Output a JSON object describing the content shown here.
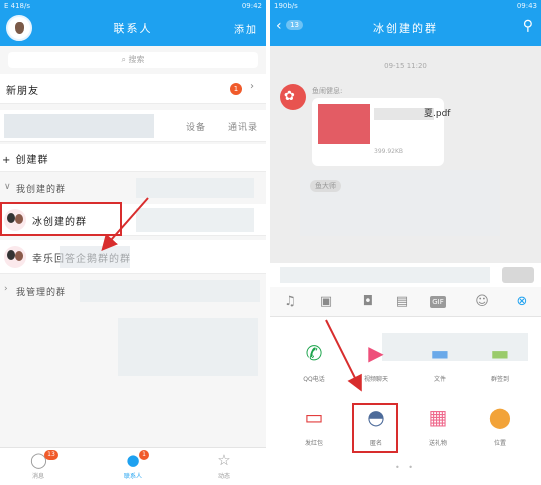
{
  "left": {
    "status": {
      "left": "E 418/s",
      "right": "09:42"
    },
    "nav": {
      "title": "联系人",
      "right_action": "添加"
    },
    "search": {
      "placeholder": "搜索"
    },
    "new_friends": {
      "label": "新朋友",
      "badge": "1"
    },
    "device_tabs": [
      "设备",
      "通讯录"
    ],
    "create_group": {
      "label": "+ 创建群"
    },
    "my_groups_header": {
      "label": "我创建的群"
    },
    "groups": [
      {
        "name": "冰创建的群"
      },
      {
        "name": "幸乐回答企鹅群的群"
      }
    ],
    "managed_groups_header": {
      "label": "我管理的群"
    },
    "tabbar": [
      {
        "label": "消息",
        "icon": "chat-bubble-icon",
        "badge": "13"
      },
      {
        "label": "联系人",
        "icon": "contacts-icon",
        "badge": "1"
      },
      {
        "label": "动态",
        "icon": "star-icon"
      }
    ]
  },
  "right": {
    "status": {
      "left": "190b/s",
      "right": "09:43"
    },
    "nav": {
      "back_badge": "13",
      "title": "冰创建的群"
    },
    "time_chip": "09-15 11:20",
    "sender_label": "鱼闹健息:",
    "file": {
      "name": "夏.pdf",
      "size": "399.92KB"
    },
    "receiver_label": "鱼大师",
    "toolbar_icons": [
      "mic-icon",
      "image-icon",
      "camera-icon",
      "emoji-picker-icon",
      "gif-icon",
      "smile-icon",
      "close-icon"
    ],
    "functions": [
      {
        "label": "QQ电话",
        "icon": "phone-icon"
      },
      {
        "label": "视频聊天",
        "icon": "video-icon"
      },
      {
        "label": "文件",
        "icon": "file-icon"
      },
      {
        "label": "群签到",
        "icon": "checkin-icon"
      },
      {
        "label": "发红包",
        "icon": "red-envelope-icon"
      },
      {
        "label": "匿名",
        "icon": "anonymous-icon"
      },
      {
        "label": "送礼物",
        "icon": "gift-icon"
      },
      {
        "label": "位置",
        "icon": "location-icon"
      }
    ],
    "page_dots": "• •"
  },
  "colors": {
    "accent": "#1ea1f0",
    "highlight_red": "#d82d2d",
    "badge": "#f05a2a"
  }
}
